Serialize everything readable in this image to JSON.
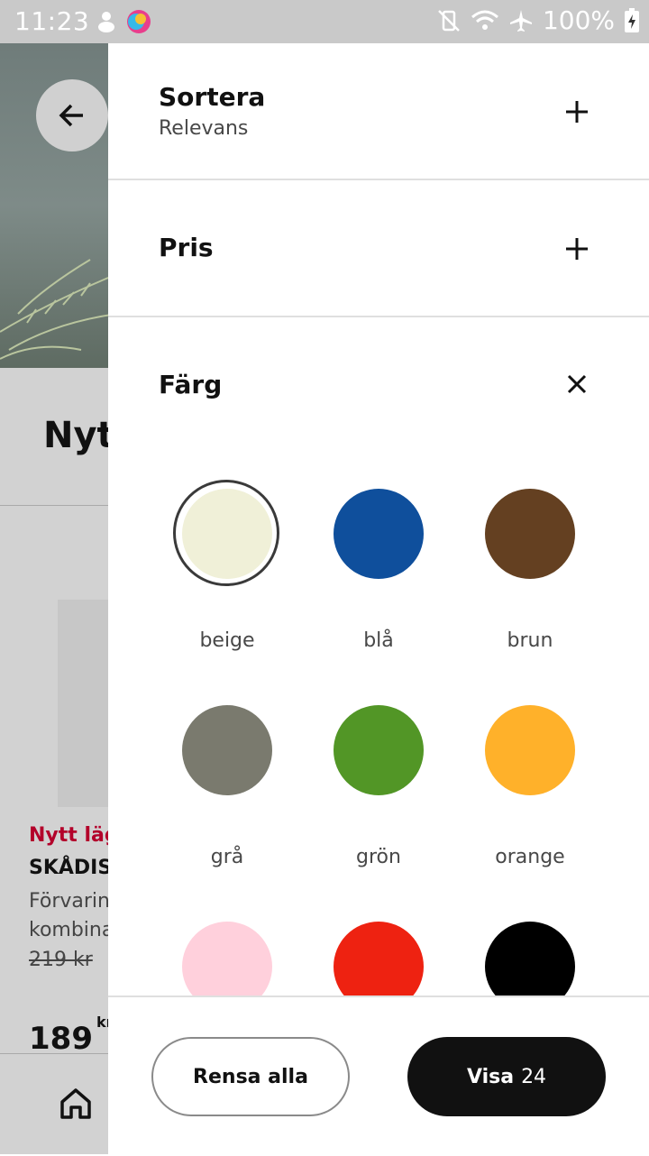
{
  "status_bar": {
    "time": "11:23",
    "battery": "100%"
  },
  "background_page": {
    "title": "Nytt",
    "product": {
      "badge": "Nytt läg",
      "name": "SKÅDIS",
      "description_1": "Förvarin",
      "description_2": "kombina",
      "old_price": "219 kr",
      "price": "189",
      "currency": "kr"
    }
  },
  "filter_panel": {
    "sort": {
      "title": "Sortera",
      "value": "Relevans",
      "icon": "plus-icon"
    },
    "price": {
      "title": "Pris",
      "icon": "plus-icon"
    },
    "color": {
      "title": "Färg",
      "icon": "close-icon",
      "options": [
        {
          "label": "beige",
          "color": "#f0f0d8",
          "selected": true
        },
        {
          "label": "blå",
          "color": "#0f4f9c"
        },
        {
          "label": "brun",
          "color": "#644021"
        },
        {
          "label": "grå",
          "color": "#7a7a6e"
        },
        {
          "label": "grön",
          "color": "#529626"
        },
        {
          "label": "orange",
          "color": "#ffb12a"
        },
        {
          "label": "",
          "color": "#ffd0dc"
        },
        {
          "label": "",
          "color": "#ee2211"
        },
        {
          "label": "",
          "color": "#000000"
        }
      ]
    },
    "footer": {
      "clear_label": "Rensa alla",
      "show_label": "Visa",
      "show_count": "24"
    }
  }
}
